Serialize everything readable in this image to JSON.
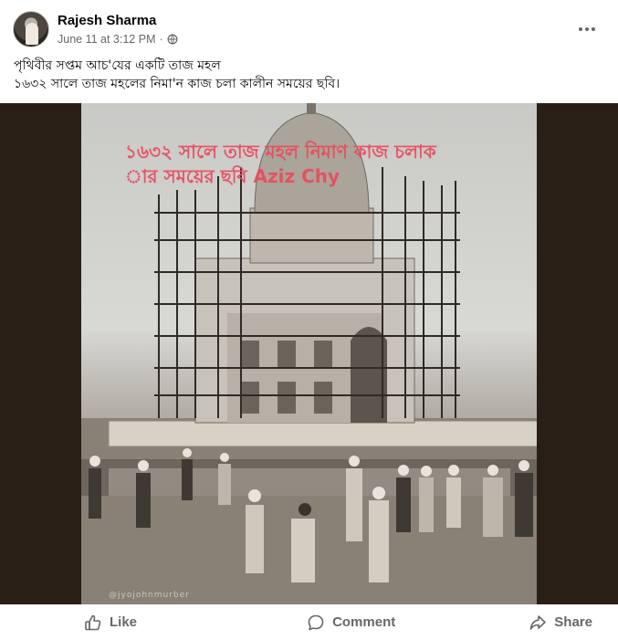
{
  "post": {
    "author": "Rajesh Sharma",
    "timestamp": "June 11 at 3:12 PM",
    "separator": "·",
    "privacy_icon": "globe-icon",
    "more_icon": "more-options-icon",
    "caption_line1": "পৃথিবীর সপ্তম আচ'যের একটি তাজ মহল",
    "caption_line2": "১৬৩২ সালে তাজ মহলের নিমা'ন কাজ চলা কালীন সময়ের ছবি।"
  },
  "image": {
    "overlay_line1": "১৬৩২ সালে তাজ মহল নিমাণ কাজ চলাক",
    "overlay_line2": "ার সময়ের ছবি  Aziz Chy",
    "watermark": "@jyojohnmurber",
    "overlay_color": "#ea4a5c"
  },
  "actions": {
    "like_label": "Like",
    "comment_label": "Comment",
    "share_label": "Share",
    "like_icon": "thumbs-up-icon",
    "comment_icon": "speech-bubble-icon",
    "share_icon": "share-arrow-icon"
  },
  "colors": {
    "secondary_text": "#65676b",
    "primary_text": "#050505",
    "media_background": "#2a1f17"
  }
}
